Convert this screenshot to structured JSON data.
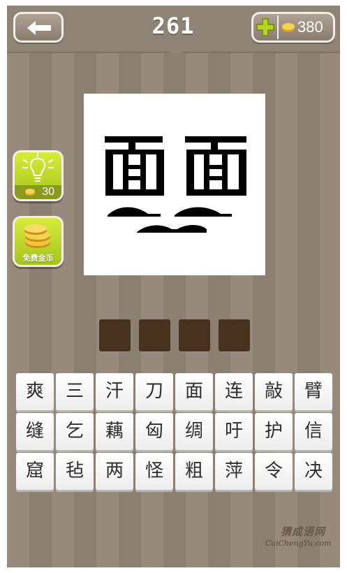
{
  "header": {
    "level": "261",
    "coins": "380",
    "back_icon": "back-arrow-icon",
    "add_icon": "plus-icon",
    "coin_icon": "coin-icon"
  },
  "side_buttons": {
    "hint": {
      "icon": "lightbulb-icon",
      "cost": "30"
    },
    "free_coins": {
      "icon": "coin-stack-icon",
      "label": "免费金币"
    }
  },
  "puzzle": {
    "image_characters": [
      "面",
      "面"
    ]
  },
  "answer": {
    "slot_count": 4,
    "slots": [
      "",
      "",
      "",
      ""
    ]
  },
  "character_grid": [
    [
      "爽",
      "三",
      "汗",
      "刀",
      "面",
      "连",
      "敲",
      "臂"
    ],
    [
      "缝",
      "乞",
      "藕",
      "匈",
      "绸",
      "吁",
      "护",
      "信"
    ],
    [
      "窟",
      "毡",
      "两",
      "怪",
      "粗",
      "萍",
      "令",
      "决"
    ]
  ],
  "watermark": {
    "cn": "猜成语网",
    "en": "CaiChengYu.com"
  },
  "colors": {
    "accent_green": "#c5dc2c",
    "slot_brown": "#47321f",
    "stripe_light": "#978a7c",
    "stripe_dark": "#8b7f71"
  }
}
